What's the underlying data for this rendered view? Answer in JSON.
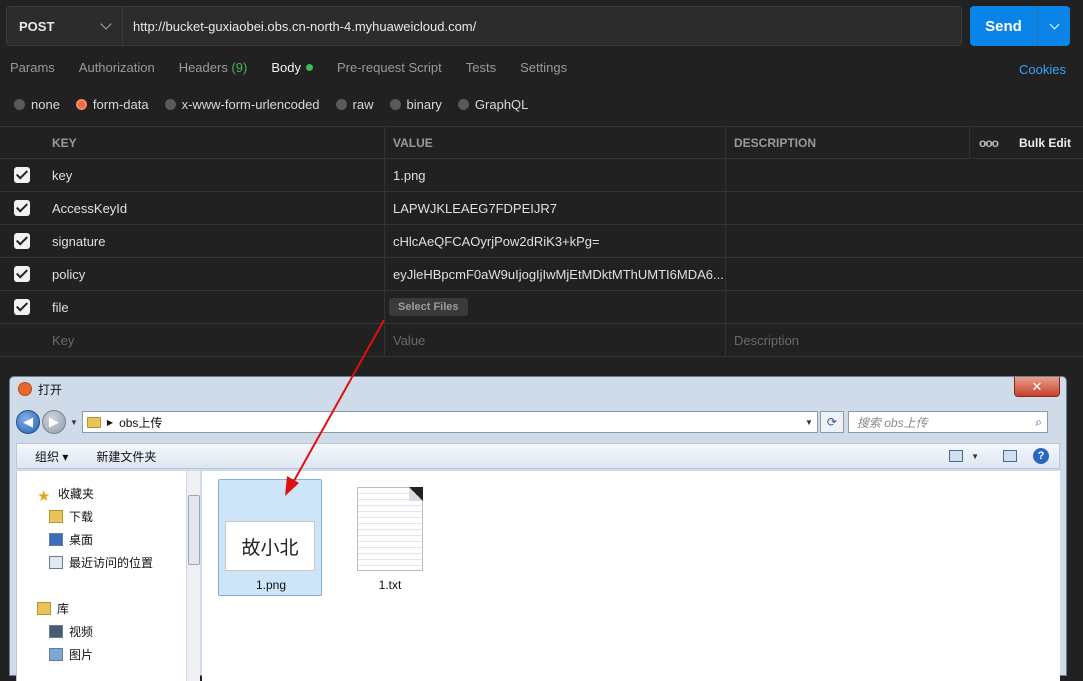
{
  "request": {
    "method": "POST",
    "url": "http://bucket-guxiaobei.obs.cn-north-4.myhuaweicloud.com/",
    "send_label": "Send"
  },
  "tabs": [
    {
      "label": "Params"
    },
    {
      "label": "Authorization"
    },
    {
      "label": "Headers",
      "count": "(9)"
    },
    {
      "label": "Body"
    },
    {
      "label": "Pre-request Script"
    },
    {
      "label": "Tests"
    },
    {
      "label": "Settings"
    }
  ],
  "cookies_label": "Cookies",
  "body_types": [
    "none",
    "form-data",
    "x-www-form-urlencoded",
    "raw",
    "binary",
    "GraphQL"
  ],
  "table": {
    "headers": {
      "key": "KEY",
      "value": "VALUE",
      "description": "DESCRIPTION",
      "more": "ooo",
      "bulk_edit": "Bulk Edit"
    },
    "rows": [
      {
        "key": "key",
        "value": "1.png"
      },
      {
        "key": "AccessKeyId",
        "value": "LAPWJKLEAEG7FDPEIJR7"
      },
      {
        "key": "signature",
        "value": "cHlcAeQFCAOyrjPow2dRiK3+kPg="
      },
      {
        "key": "policy",
        "value": "eyJleHBpcmF0aW9uIjogIjIwMjEtMDktMThUMTI6MDA6..."
      },
      {
        "key": "file",
        "value": "Select Files"
      }
    ],
    "placeholders": {
      "key": "Key",
      "value": "Value",
      "description": "Description"
    }
  },
  "dialog": {
    "title": "打开",
    "close": "✕",
    "address": "obs上传",
    "search_placeholder": "搜索 obs上传",
    "toolbar": {
      "organize": "组织 ▾",
      "new_folder": "新建文件夹"
    },
    "sidebar": {
      "favorites": "收藏夹",
      "downloads": "下载",
      "desktop": "桌面",
      "recent": "最近访问的位置",
      "libraries": "库",
      "videos": "视频",
      "pictures": "图片"
    },
    "files": [
      {
        "name": "1.png",
        "thumb_text": "故小北"
      },
      {
        "name": "1.txt"
      }
    ]
  },
  "colors": {
    "accent": "#0a84e6",
    "status_green": "#3fb950",
    "radio_on": "#ef6b43",
    "arrow": "#e01010"
  }
}
